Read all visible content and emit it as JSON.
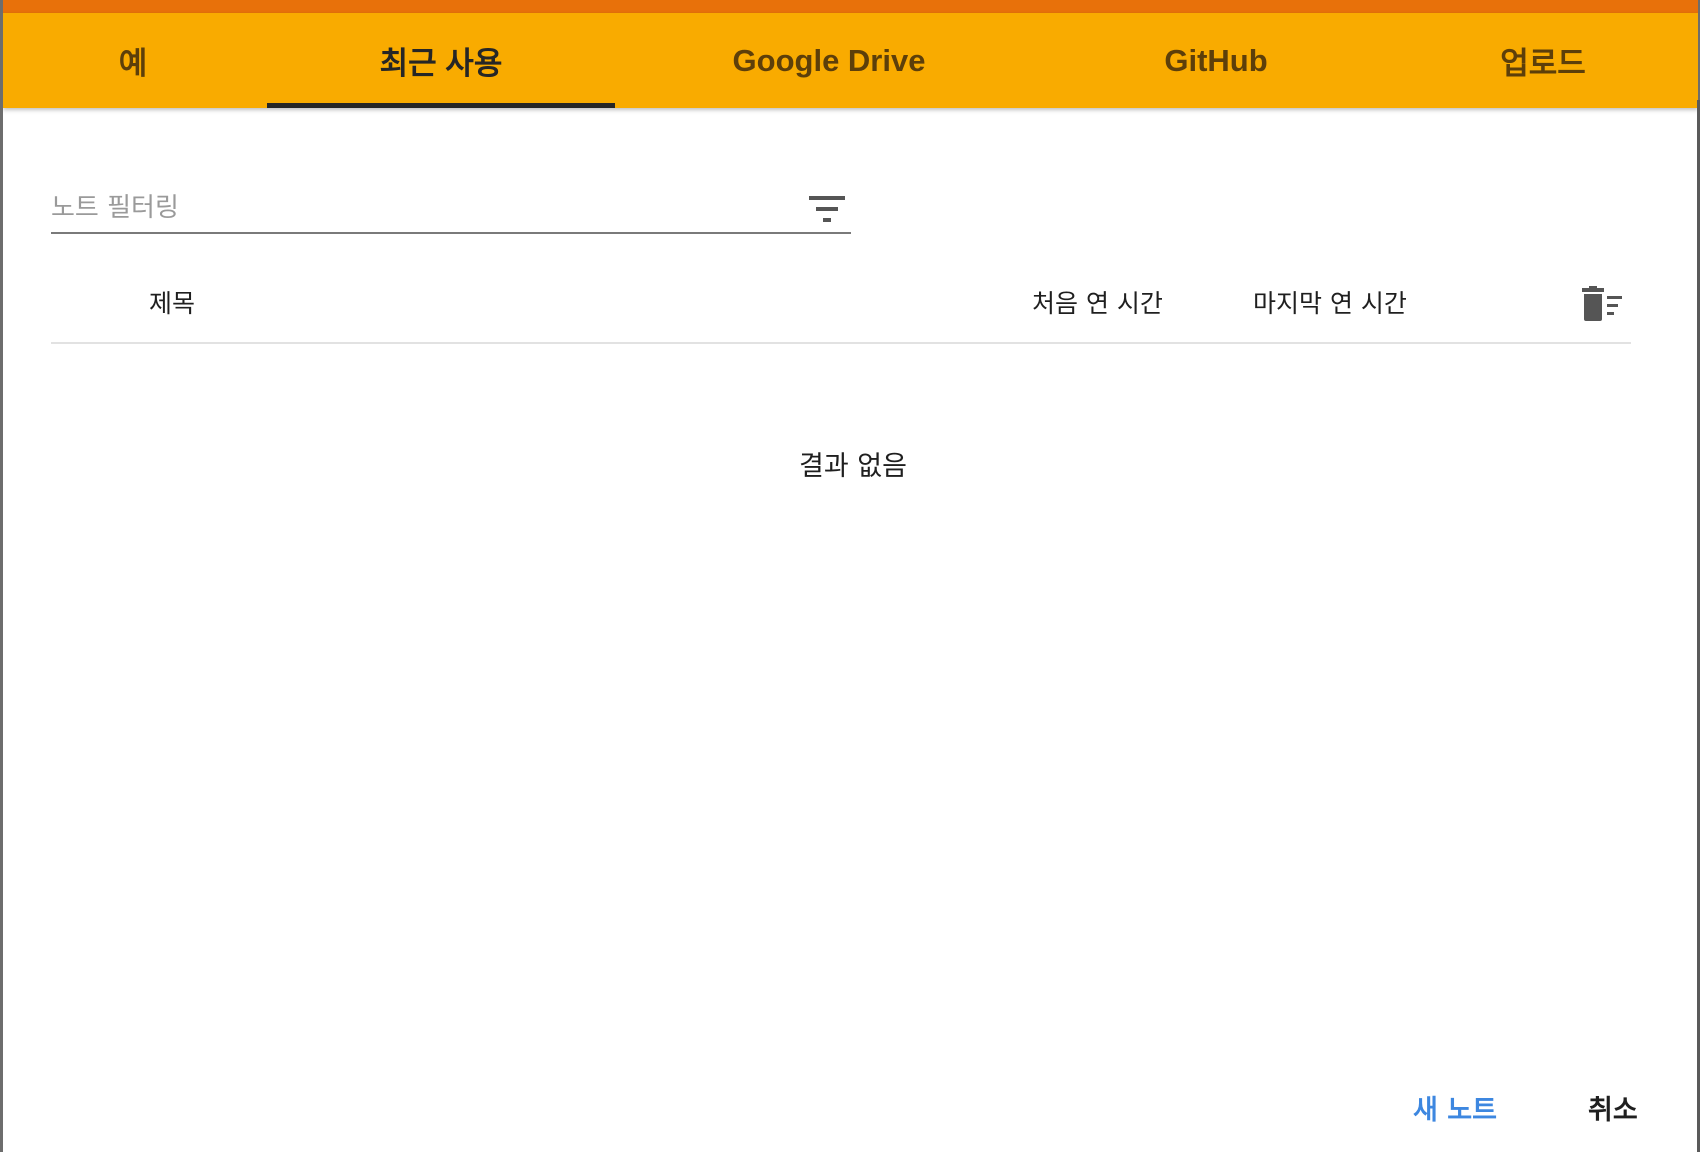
{
  "tabs": [
    {
      "label": "예",
      "active": false
    },
    {
      "label": "최근 사용",
      "active": true
    },
    {
      "label": "Google Drive",
      "active": false
    },
    {
      "label": "GitHub",
      "active": false
    },
    {
      "label": "업로드",
      "active": false
    }
  ],
  "filter": {
    "placeholder": "노트 필터링",
    "icon": "filter-icon"
  },
  "table": {
    "columns": {
      "title": "제목",
      "first_opened": "처음 연 시간",
      "last_opened": "마지막 연 시간"
    },
    "delete_icon": "trash-icon",
    "empty_message": "결과 없음"
  },
  "actions": {
    "new_notebook": "새 노트",
    "cancel": "취소"
  },
  "colors": {
    "tab_bar": "#f9ab00",
    "accent_top": "#e8710a",
    "link_blue": "#3d87e0"
  }
}
